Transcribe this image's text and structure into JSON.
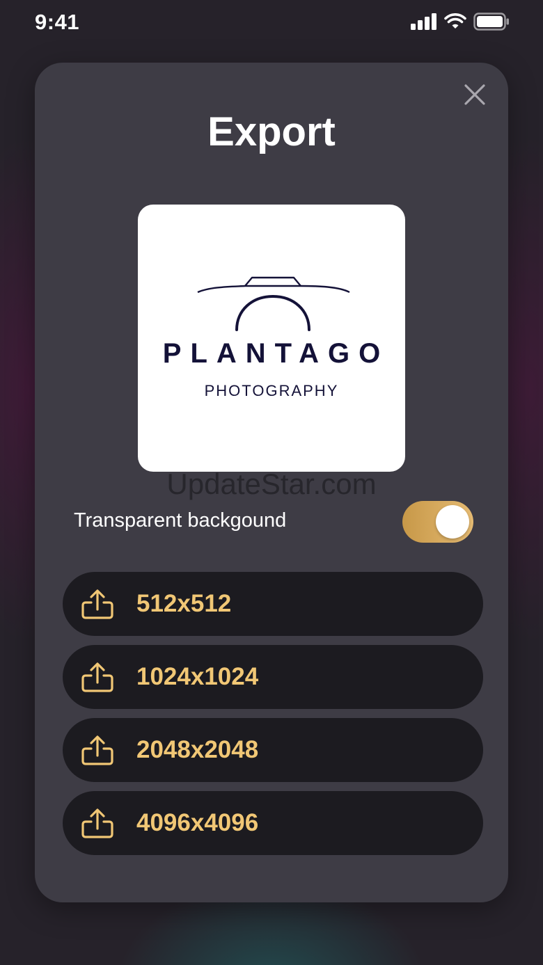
{
  "status_bar": {
    "time": "9:41"
  },
  "modal": {
    "title": "Export",
    "preview": {
      "logo_name": "PLANTAGO",
      "logo_subtitle": "PHOTOGRAPHY"
    },
    "watermark": "UpdateStar.com",
    "transparent_toggle": {
      "label": "Transparent backgound",
      "on": true
    },
    "export_options": [
      {
        "label": "512x512"
      },
      {
        "label": "1024x1024"
      },
      {
        "label": "2048x2048"
      },
      {
        "label": "4096x4096"
      }
    ]
  },
  "colors": {
    "accent": "#f1c775",
    "toggle_start": "#c79848",
    "toggle_end": "#e6bb73",
    "modal_bg": "#3e3c45",
    "button_bg": "#1c1b20",
    "logo_navy": "#141238"
  },
  "icons": {
    "close": "close-icon",
    "export": "share-upload-icon",
    "signal": "cellular-signal-icon",
    "wifi": "wifi-icon",
    "battery": "battery-icon"
  }
}
